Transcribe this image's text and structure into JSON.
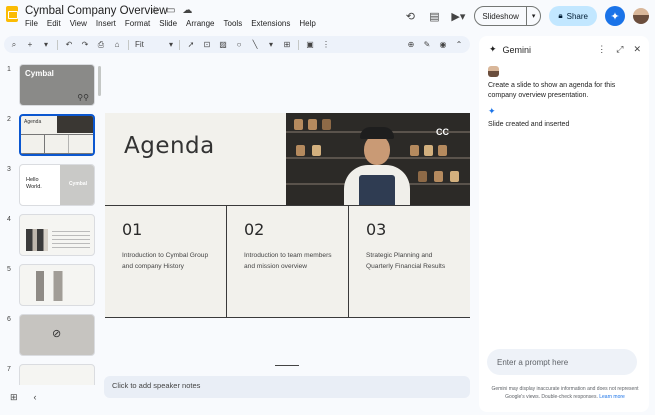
{
  "document": {
    "title": "Cymbal Company Overview",
    "menu": [
      "File",
      "Edit",
      "View",
      "Insert",
      "Format",
      "Slide",
      "Arrange",
      "Tools",
      "Extensions",
      "Help"
    ]
  },
  "top_actions": {
    "slideshow_label": "Slideshow",
    "share_label": "Share"
  },
  "toolbar": {
    "zoom_value": "Fit"
  },
  "thumbnails": [
    {
      "number": "1",
      "caption": "Cymbal"
    },
    {
      "number": "2",
      "caption": "Agenda"
    },
    {
      "number": "3",
      "caption": "Hello World.",
      "logo": "Cymbal"
    },
    {
      "number": "4",
      "caption": ""
    },
    {
      "number": "5",
      "caption": ""
    },
    {
      "number": "6",
      "caption": ""
    },
    {
      "number": "7",
      "caption": ""
    }
  ],
  "slide": {
    "title": "Agenda",
    "photo_logo": "CC",
    "items": [
      {
        "number": "01",
        "text": "Introduction to Cymbal Group and company History"
      },
      {
        "number": "02",
        "text": "Introduction to team members and mission overview"
      },
      {
        "number": "03",
        "text": "Strategic Planning and Quarterly Financial Results"
      }
    ]
  },
  "speaker_notes": {
    "placeholder": "Click to add speaker notes"
  },
  "gemini": {
    "title": "Gemini",
    "user_prompt": "Create a slide to show an agenda for this company overview presentation.",
    "response": "Slide created and inserted",
    "input_placeholder": "Enter a prompt here",
    "disclaimer": "Gemini may display inaccurate information and does not represent Google's views. Double-check responses.",
    "disclaimer_link": "Learn more"
  },
  "colors": {
    "accent_blue": "#0b57d0",
    "share_bg": "#c2e7ff",
    "slide_bg": "#f2f1ec",
    "app_bg": "#f8fafd"
  }
}
